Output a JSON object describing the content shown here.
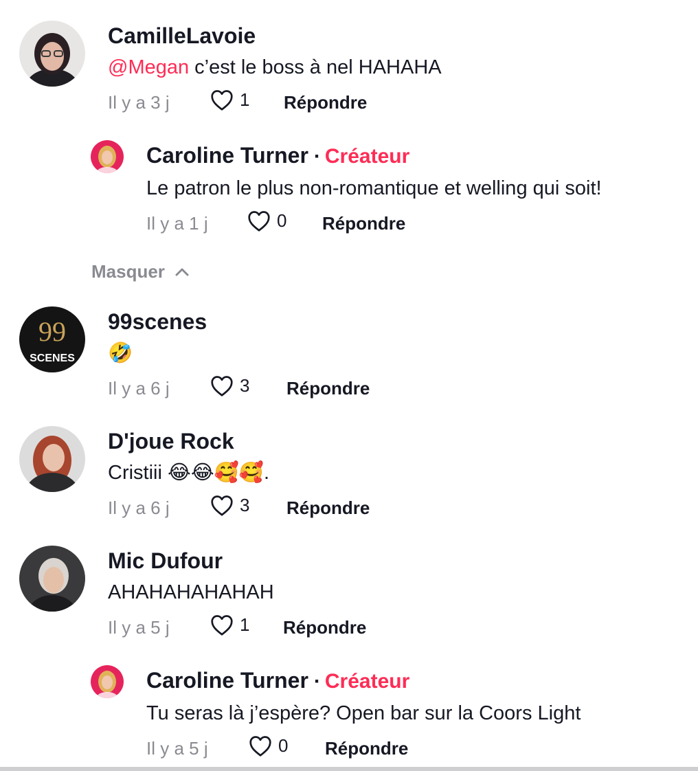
{
  "comments": [
    {
      "username": "CamilleLavoie",
      "mention": "@Megan",
      "text": " c’est le boss à nel HAHAHA",
      "time": "Il y a 3 j",
      "likes": "1",
      "reply_label": "Répondre",
      "avatar_icon": "user-avatar-icon",
      "replies": [
        {
          "username": "Caroline Turner",
          "separator": "·",
          "badge": "Créateur",
          "text": "Le patron le plus non-romantique et welling qui soit!",
          "time": "Il y a 1 j",
          "likes": "0",
          "reply_label": "Répondre"
        }
      ]
    },
    {
      "username": "99scenes",
      "text": "🤣",
      "time": "Il y a 6 j",
      "likes": "3",
      "reply_label": "Répondre",
      "avatar_logo": {
        "top": "99",
        "bottom": "SCENES"
      }
    },
    {
      "username": "D'joue Rock",
      "text": "Cristiii 😂😂🥰🥰.",
      "time": "Il y a 6 j",
      "likes": "3",
      "reply_label": "Répondre"
    },
    {
      "username": "Mic Dufour",
      "text": "AHAHAHAHAHAH",
      "time": "Il y a 5 j",
      "likes": "1",
      "reply_label": "Répondre",
      "replies": [
        {
          "username": "Caroline Turner",
          "separator": "·",
          "badge": "Créateur",
          "text": "Tu seras là j’espère? Open bar sur la Coors Light",
          "time": "Il y a 5 j",
          "likes": "0",
          "reply_label": "Répondre"
        }
      ]
    }
  ],
  "hide_replies_label": "Masquer",
  "colors": {
    "accent": "#fe2c55",
    "text": "#161823",
    "muted": "#8a8b91"
  }
}
